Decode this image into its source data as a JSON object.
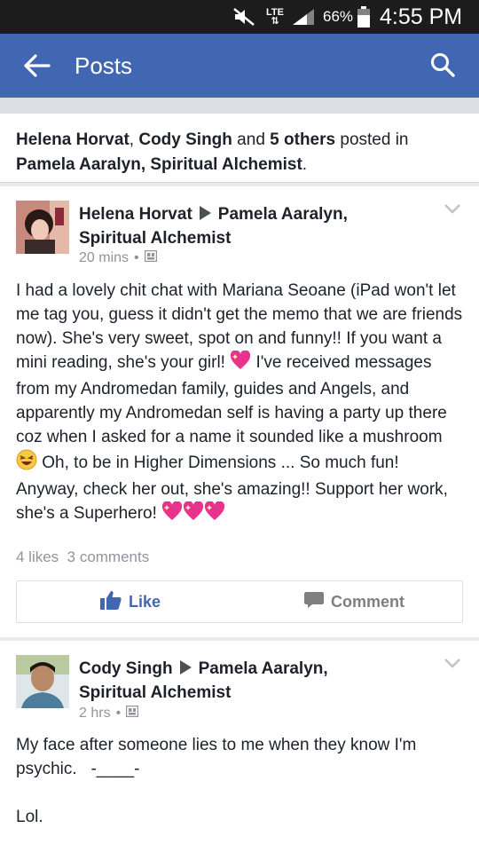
{
  "status": {
    "network": "LTE",
    "battery": "66%",
    "time": "4:55 PM"
  },
  "header": {
    "title": "Posts"
  },
  "summary": {
    "name1": "Helena Horvat",
    "sep1": ", ",
    "name2": "Cody Singh",
    "and": " and ",
    "others": "5 others",
    "posted_in": " posted in",
    "group": "Pamela Aaralyn, Spiritual Alchemist",
    "period": "."
  },
  "posts": [
    {
      "author": "Helena Horvat",
      "target_line1": "Pamela Aaralyn,",
      "target_line2": "Spiritual Alchemist",
      "time": "20 mins",
      "privacy_icon": "group-members-icon",
      "body": {
        "p1": "I had a lovely chit chat with Mariana Seoane (iPad won't let me tag you, guess it didn't get the memo that we are friends now). She's very sweet, spot on and funny!! If you want a mini reading, she's your girl! ",
        "p2": " I've received messages from my Andromedan family, guides and Angels, and apparently my Andromedan self is having a party up there coz when I asked for a name it sounded like a mushroom ",
        "p3": " Oh, to be in Higher Dimensions ... So much fun! Anyway, check her out, she's amazing!! Support her work, she's a Superhero! "
      },
      "likes": "4 likes",
      "comments": "3 comments",
      "like_label": "Like",
      "comment_label": "Comment"
    },
    {
      "author": "Cody Singh",
      "target_line1": "Pamela Aaralyn,",
      "target_line2": "Spiritual Alchemist",
      "time": "2 hrs",
      "privacy_icon": "group-members-icon",
      "body": {
        "line1": "My face after someone lies to me when they know I'm psychic.   -____-",
        "line2": "Lol."
      }
    }
  ],
  "colors": {
    "brand": "#4267b2",
    "meta": "#90949c",
    "heart": "#e8338c"
  }
}
